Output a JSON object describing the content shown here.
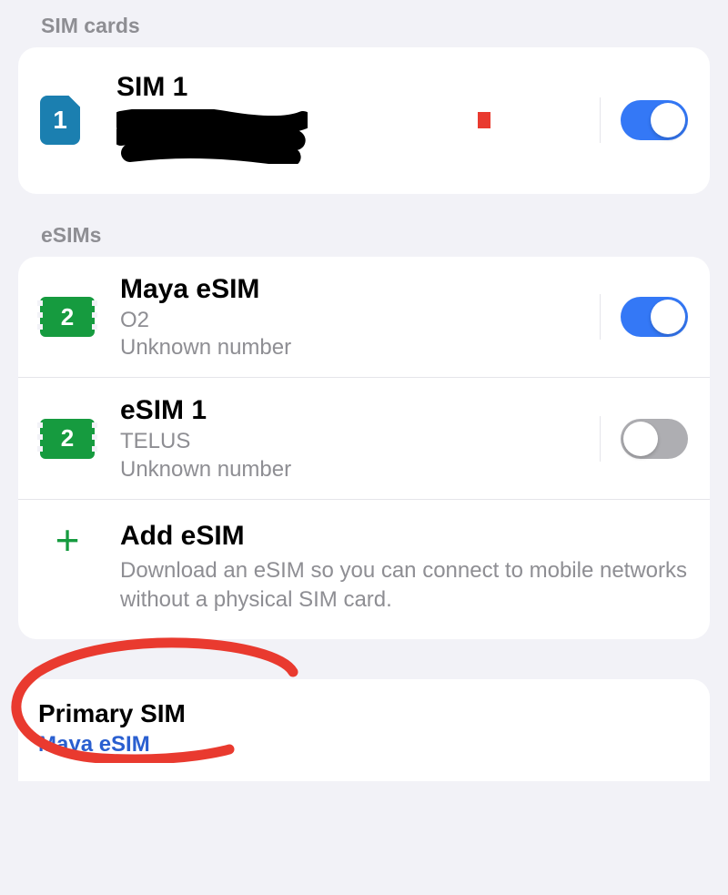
{
  "sections": {
    "sim_cards_header": "SIM cards",
    "esims_header": "eSIMs"
  },
  "sim_cards": [
    {
      "slot_number": "1",
      "title": "SIM 1",
      "details_redacted": true,
      "toggle_on": true
    }
  ],
  "esims": [
    {
      "slot_number": "2",
      "title": "Maya eSIM",
      "carrier": "O2",
      "number_status": "Unknown number",
      "toggle_on": true
    },
    {
      "slot_number": "2",
      "title": "eSIM 1",
      "carrier": "TELUS",
      "number_status": "Unknown number",
      "toggle_on": false
    }
  ],
  "add_esim": {
    "title": "Add eSIM",
    "description": "Download an eSIM so you can connect to mobile networks without a physical SIM card."
  },
  "primary_sim": {
    "label": "Primary SIM",
    "value": "Maya eSIM"
  },
  "colors": {
    "accent_blue": "#3478f6",
    "sim_blue": "#1b7fb0",
    "esim_green": "#169b3f",
    "annotation_red": "#e93a2f"
  }
}
